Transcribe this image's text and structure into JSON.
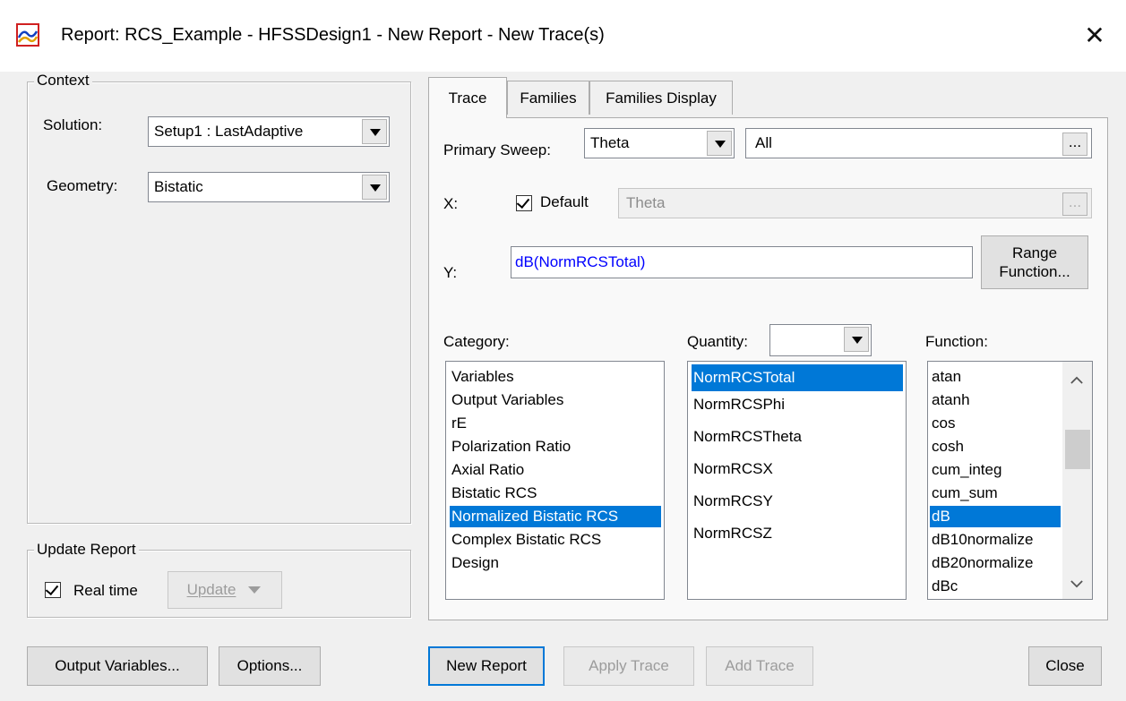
{
  "window": {
    "title": "Report: RCS_Example - HFSSDesign1 - New Report - New Trace(s)",
    "close_glyph": "✕"
  },
  "context": {
    "legend": "Context",
    "solution_label": "Solution:",
    "solution_value": "Setup1 : LastAdaptive",
    "geometry_label": "Geometry:",
    "geometry_value": "Bistatic"
  },
  "update_report": {
    "legend": "Update Report",
    "realtime_label": "Real time",
    "realtime_checked": true,
    "update_label": "Update"
  },
  "tabs": [
    {
      "label": "Trace",
      "active": true
    },
    {
      "label": "Families",
      "active": false
    },
    {
      "label": "Families Display",
      "active": false
    }
  ],
  "trace": {
    "primary_sweep_label": "Primary Sweep:",
    "primary_sweep_value": "Theta",
    "primary_sweep_range": "All",
    "ellipsis": "...",
    "x_label": "X:",
    "default_label": "Default",
    "default_checked": true,
    "x_value": "Theta",
    "y_label": "Y:",
    "y_value": "dB(NormRCSTotal)",
    "range_function_line1": "Range",
    "range_function_line2": "Function...",
    "category_label": "Category:",
    "quantity_label": "Quantity:",
    "quantity_filter": "",
    "function_label": "Function:",
    "categories": [
      "Variables",
      "Output Variables",
      "rE",
      "Polarization Ratio",
      "Axial Ratio",
      "Bistatic RCS",
      "Normalized Bistatic RCS",
      "Complex Bistatic RCS",
      "Design"
    ],
    "category_selected": "Normalized Bistatic RCS",
    "quantities": [
      "NormRCSTotal",
      "NormRCSPhi",
      "NormRCSTheta",
      "NormRCSX",
      "NormRCSY",
      "NormRCSZ"
    ],
    "quantity_selected": "NormRCSTotal",
    "functions": [
      "atan",
      "atanh",
      "cos",
      "cosh",
      "cum_integ",
      "cum_sum",
      "dB",
      "dB10normalize",
      "dB20normalize",
      "dBc"
    ],
    "function_selected": "dB"
  },
  "buttons": {
    "output_variables": "Output Variables...",
    "options": "Options...",
    "new_report": "New Report",
    "apply_trace": "Apply Trace",
    "add_trace": "Add Trace",
    "close": "Close"
  },
  "colors": {
    "selection": "#0078d7",
    "y_expression": "#0000ff",
    "dialog_bg": "#f0f0f0"
  }
}
